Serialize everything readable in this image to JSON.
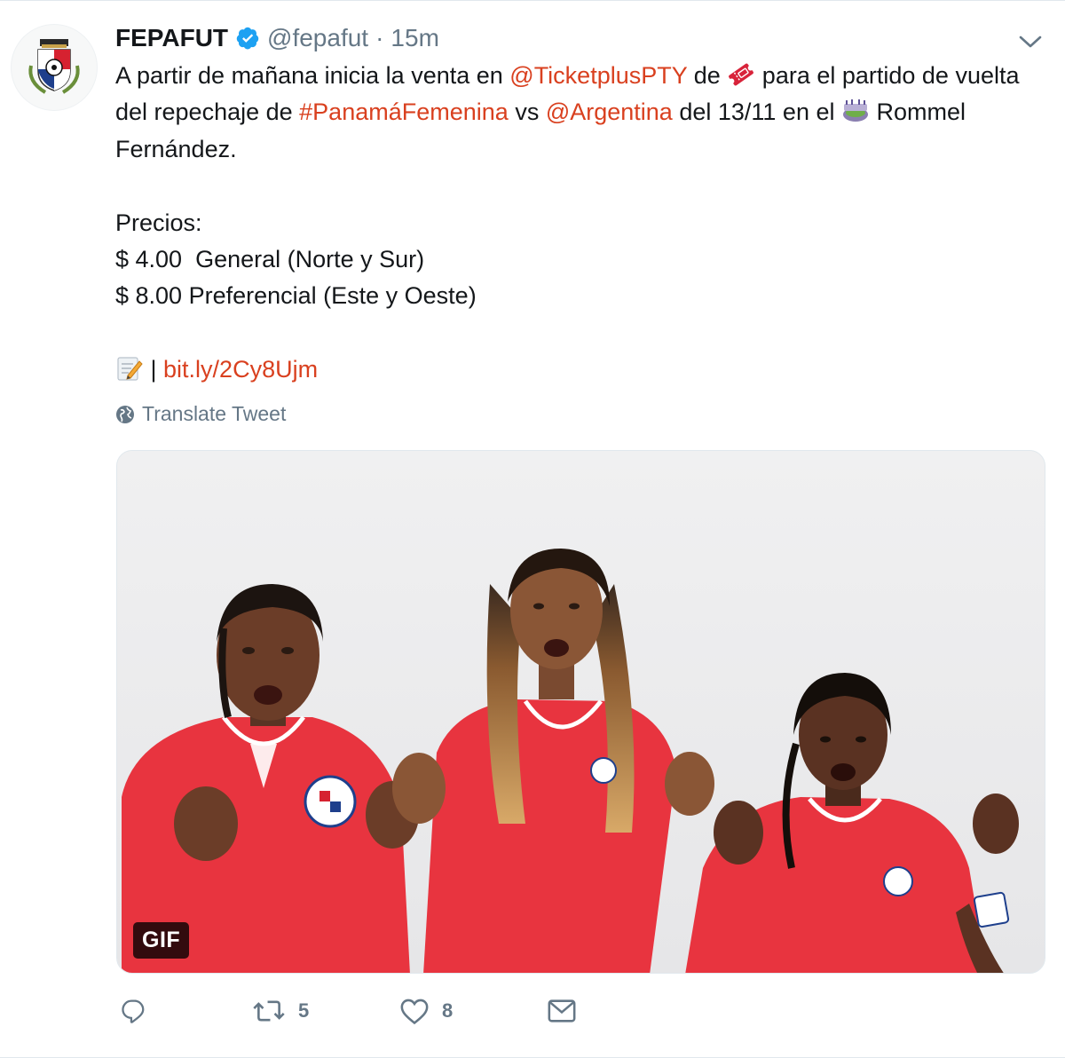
{
  "tweet": {
    "author": {
      "name": "FEPAFUT",
      "handle": "@fepafut",
      "separator": "·",
      "time": "15m"
    },
    "text": {
      "line1_pre": "A partir de mañana inicia la venta en ",
      "mention_ticket": "@TicketplusPTY",
      "line1_post": " de ",
      "line1_tail": " para el partido de vuelta del repechaje de ",
      "hashtag": "#PanamáFemenina",
      "vs": " vs ",
      "mention_arg": "@Argentina",
      "date_part": " del 13/11 en el ",
      "stadium": " Rommel Fernández.",
      "prices_label": "Precios:",
      "price_general": "$ 4.00  General (Norte y Sur)",
      "price_pref": "$ 8.00 Preferencial (Este y Oeste)",
      "link_sep": " | ",
      "link": "bit.ly/2Cy8Ujm"
    },
    "translate_label": "Translate Tweet",
    "media": {
      "badge": "GIF"
    },
    "actions": {
      "reply_count": "",
      "retweet_count": "5",
      "like_count": "8"
    }
  },
  "colors": {
    "link": "#d9401f",
    "muted": "#657786",
    "verified": "#1da1f2",
    "jersey": "#e8343f"
  },
  "icons": [
    "verified-badge-icon",
    "chevron-down-icon",
    "ticket-emoji-icon",
    "stadium-emoji-icon",
    "memo-emoji-icon",
    "globe-icon",
    "reply-icon",
    "retweet-icon",
    "heart-icon",
    "message-icon"
  ]
}
